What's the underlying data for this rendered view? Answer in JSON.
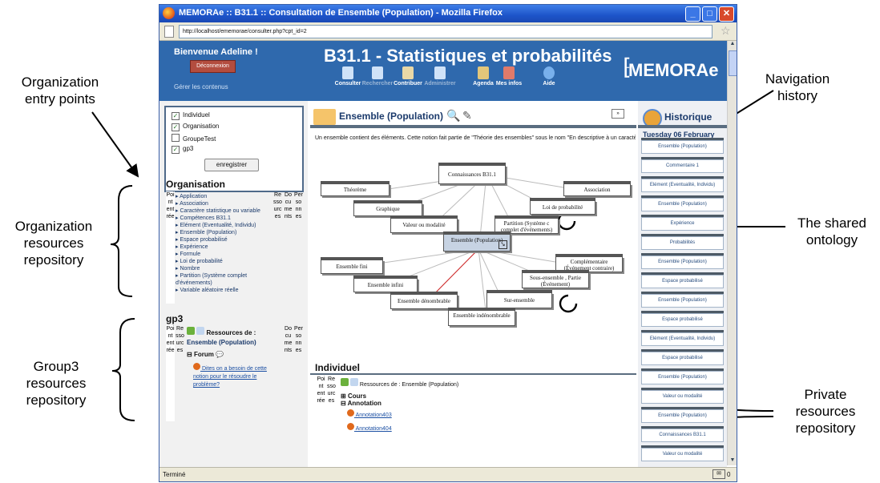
{
  "annotations": {
    "org_entry": "Organization\nentry points",
    "org_repo": "Organization\nresources\nrepository",
    "group_repo": "Group3\nresources\nrepository",
    "nav_history": "Navigation\nhistory",
    "shared_onto": "The shared\nontology",
    "private_repo": "Private\nresources\nrepository"
  },
  "browser": {
    "title": "MEMORAe :: B31.1 :: Consultation de Ensemble (Population) - Mozilla Firefox",
    "url": "http://localhost/ememorae/consulter.php?cpt_id=2",
    "status": "Terminé",
    "mail_count": "0"
  },
  "header": {
    "welcome": "Bienvenue Adeline !",
    "logout": "Déconnexion",
    "manage": "Gérer les contenus",
    "title": "B31.1 - Statistiques et probabilités",
    "logo": "MEMORAe",
    "nav": [
      "Consulter",
      "Rechercher",
      "Contribuer",
      "Administrer",
      "Agenda",
      "Mes infos",
      "Aide"
    ]
  },
  "left": {
    "checkboxes": [
      {
        "label": "Individuel",
        "checked": true
      },
      {
        "label": "Organisation",
        "checked": true
      },
      {
        "label": "GroupeTest",
        "checked": false
      },
      {
        "label": "gp3",
        "checked": true
      }
    ],
    "save": "enregistrer",
    "org_title": "Organisation",
    "org_items": [
      "Application",
      "Association",
      "Caractère statistique ou variable",
      "Compétences B31.1",
      "Elément (Eventualité, Individu)",
      "Ensemble (Population)",
      "Espace probabilisé",
      "Expérience",
      "Formule",
      "Loi de probabilité",
      "Nombre",
      "Partition (Système complet d'événements)",
      "Variable aléatoire réelle"
    ],
    "vert_pe": "Point entrée",
    "vert_res": "Ressources",
    "vert_doc": "Documents",
    "vert_pers": "Personnes",
    "gp3_title": "gp3",
    "gp3_res_label": "Ressources de :",
    "gp3_concept": "Ensemble (Population)",
    "forum": "Forum",
    "forum_link": "Dites on a besoin de cette notion pour le résoudre le problème?"
  },
  "center": {
    "concept_title": "Ensemble (Population)",
    "description": "Un ensemble contient des éléments. Cette notion fait partie de \"Théorie des ensembles\" sous le nom \"En descriptive à un caractère\" sous le nom \"Population\".",
    "nodes": {
      "n1": "Connaissances B31.1",
      "n2": "Théorème",
      "n3": "Association",
      "n4": "Graphique",
      "n5": "Loi de probabilité",
      "n6": "Valeur ou modalité",
      "n7": "Partition (Système c complet d'événements)",
      "n8": "Ensemble (Population)",
      "n9": "Ensemble fini",
      "n10": "Complémentaire (Événement contraire)",
      "n11": "Ensemble infini",
      "n12": "Sous-ensemble , Partie (Événement)",
      "n13": "Ensemble dénombrable",
      "n14": "Sur-ensemble",
      "n15": "Ensemble indénombrable"
    },
    "indiv_title": "Individuel",
    "indiv_res_label": "Ressources de : Ensemble (Population)",
    "cours": "Cours",
    "annotation": "Annotation",
    "annotations": [
      "Annotation403",
      "Annotation404"
    ]
  },
  "right": {
    "title": "Historique",
    "date": "Tuesday 06 February",
    "items": [
      "Ensemble (Population)",
      "Commentaire 1",
      "Elément (Eventualité, Individu)",
      "Ensemble (Population)",
      "Expérience",
      "Probabilités",
      "Ensemble (Population)",
      "Espace probabilisé",
      "Ensemble (Population)",
      "Espace probabilisé",
      "Elément (Eventualité, Individu)",
      "Espace probabilisé",
      "Ensemble (Population)",
      "Valeur ou modalité",
      "Ensemble (Population)",
      "Connaissances B31.1",
      "Valeur ou modalité"
    ]
  }
}
